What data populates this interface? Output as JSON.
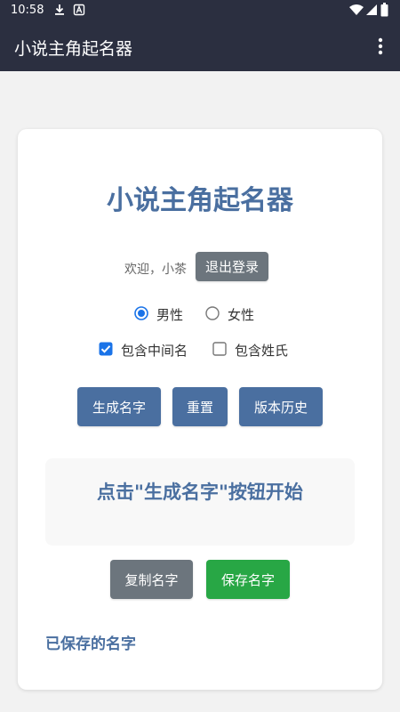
{
  "status_bar": {
    "time": "10:58",
    "icons": [
      "download-icon",
      "notification-a-icon",
      "wifi-icon",
      "signal-icon",
      "battery-icon"
    ]
  },
  "app_bar": {
    "title": "小说主角起名器",
    "menu_icon": "more-vert-icon"
  },
  "main": {
    "title": "小说主角起名器",
    "welcome": "欢迎，小茶",
    "logout_label": "退出登录",
    "gender": {
      "male_label": "男性",
      "female_label": "女性",
      "selected": "male"
    },
    "options": {
      "middle_name_label": "包含中间名",
      "middle_name_checked": true,
      "surname_label": "包含姓氏",
      "surname_checked": false
    },
    "buttons": {
      "generate_label": "生成名字",
      "reset_label": "重置",
      "history_label": "版本历史"
    },
    "result_text": "点击\"生成名字\"按钮开始",
    "copy_label": "复制名字",
    "save_label": "保存名字",
    "saved_heading": "已保存的名字"
  },
  "colors": {
    "primary": "#4a6fa0",
    "app_bar": "#2b2f40",
    "gray_button": "#6c757d",
    "green_button": "#28a745",
    "radio_checkbox_accent": "#1a73e8"
  }
}
